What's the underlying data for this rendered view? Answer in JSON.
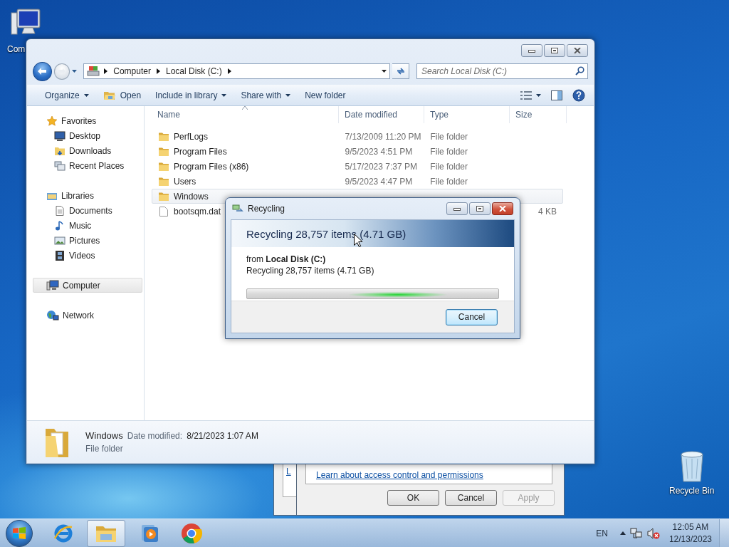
{
  "desktop_icons": [
    {
      "label": "Com"
    },
    {
      "label": "Recycle Bin"
    }
  ],
  "explorer": {
    "address": {
      "breadcrumbs": [
        "Computer",
        "Local Disk (C:)"
      ]
    },
    "search": {
      "placeholder": "Search Local Disk (C:)"
    },
    "toolbar": [
      {
        "label": "Organize",
        "dropdown": true
      },
      {
        "label": "Open",
        "dropdown": false
      },
      {
        "label": "Include in library",
        "dropdown": true
      },
      {
        "label": "Share with",
        "dropdown": true
      },
      {
        "label": "New folder",
        "dropdown": false
      }
    ],
    "nav": [
      {
        "label": "Favorites",
        "selected": false,
        "children": [
          {
            "label": "Desktop",
            "selected": false
          },
          {
            "label": "Downloads",
            "selected": false
          },
          {
            "label": "Recent Places",
            "selected": false
          }
        ]
      },
      {
        "label": "Libraries",
        "selected": false,
        "children": [
          {
            "label": "Documents",
            "selected": false
          },
          {
            "label": "Music",
            "selected": false
          },
          {
            "label": "Pictures",
            "selected": false
          },
          {
            "label": "Videos",
            "selected": false
          }
        ]
      },
      {
        "label": "Computer",
        "selected": true
      },
      {
        "label": "Network",
        "selected": false
      }
    ],
    "columns": [
      "Name",
      "Date modified",
      "Type",
      "Size"
    ],
    "rows": [
      {
        "kind": "folder",
        "name": "PerfLogs",
        "date": "7/13/2009 11:20 PM",
        "type": "File folder",
        "selected": false
      },
      {
        "kind": "folder",
        "name": "Program Files",
        "date": "9/5/2023 4:51 PM",
        "type": "File folder",
        "selected": false
      },
      {
        "kind": "folder",
        "name": "Program Files (x86)",
        "date": "5/17/2023 7:37 PM",
        "type": "File folder",
        "selected": false
      },
      {
        "kind": "folder",
        "name": "Users",
        "date": "9/5/2023 4:47 PM",
        "type": "File folder",
        "selected": false
      },
      {
        "kind": "folder",
        "name": "Windows",
        "selected": true
      },
      {
        "kind": "file",
        "name": "bootsqm.dat",
        "size": "4 KB",
        "selected": false
      }
    ],
    "details": {
      "name": "Windows",
      "date_label": "Date modified:",
      "date": "8/21/2023 1:07 AM",
      "type": "File folder"
    }
  },
  "back_dialog": {
    "link": "L"
  },
  "properties_dialog": {
    "link": "Learn about access control and permissions",
    "buttons": [
      {
        "label": "OK",
        "disabled": false
      },
      {
        "label": "Cancel",
        "disabled": false
      },
      {
        "label": "Apply",
        "disabled": true
      }
    ]
  },
  "progress_dialog": {
    "title": "Recycling",
    "heading": "Recycling 28,757 items (4.71 GB)",
    "source": "from **Local Disk (C:)**",
    "status": "Recycling 28,757 items (4.71 GB)",
    "indeterminate": true,
    "button": "Cancel"
  },
  "taskbar": {
    "apps": [
      {
        "kind": "browser",
        "active": false
      },
      {
        "kind": "explorer",
        "active": true
      },
      {
        "kind": "media",
        "active": false
      },
      {
        "kind": "web",
        "active": false
      }
    ],
    "tray": {
      "language": "EN",
      "time": "12:05 AM",
      "date": "12/13/2023"
    }
  }
}
